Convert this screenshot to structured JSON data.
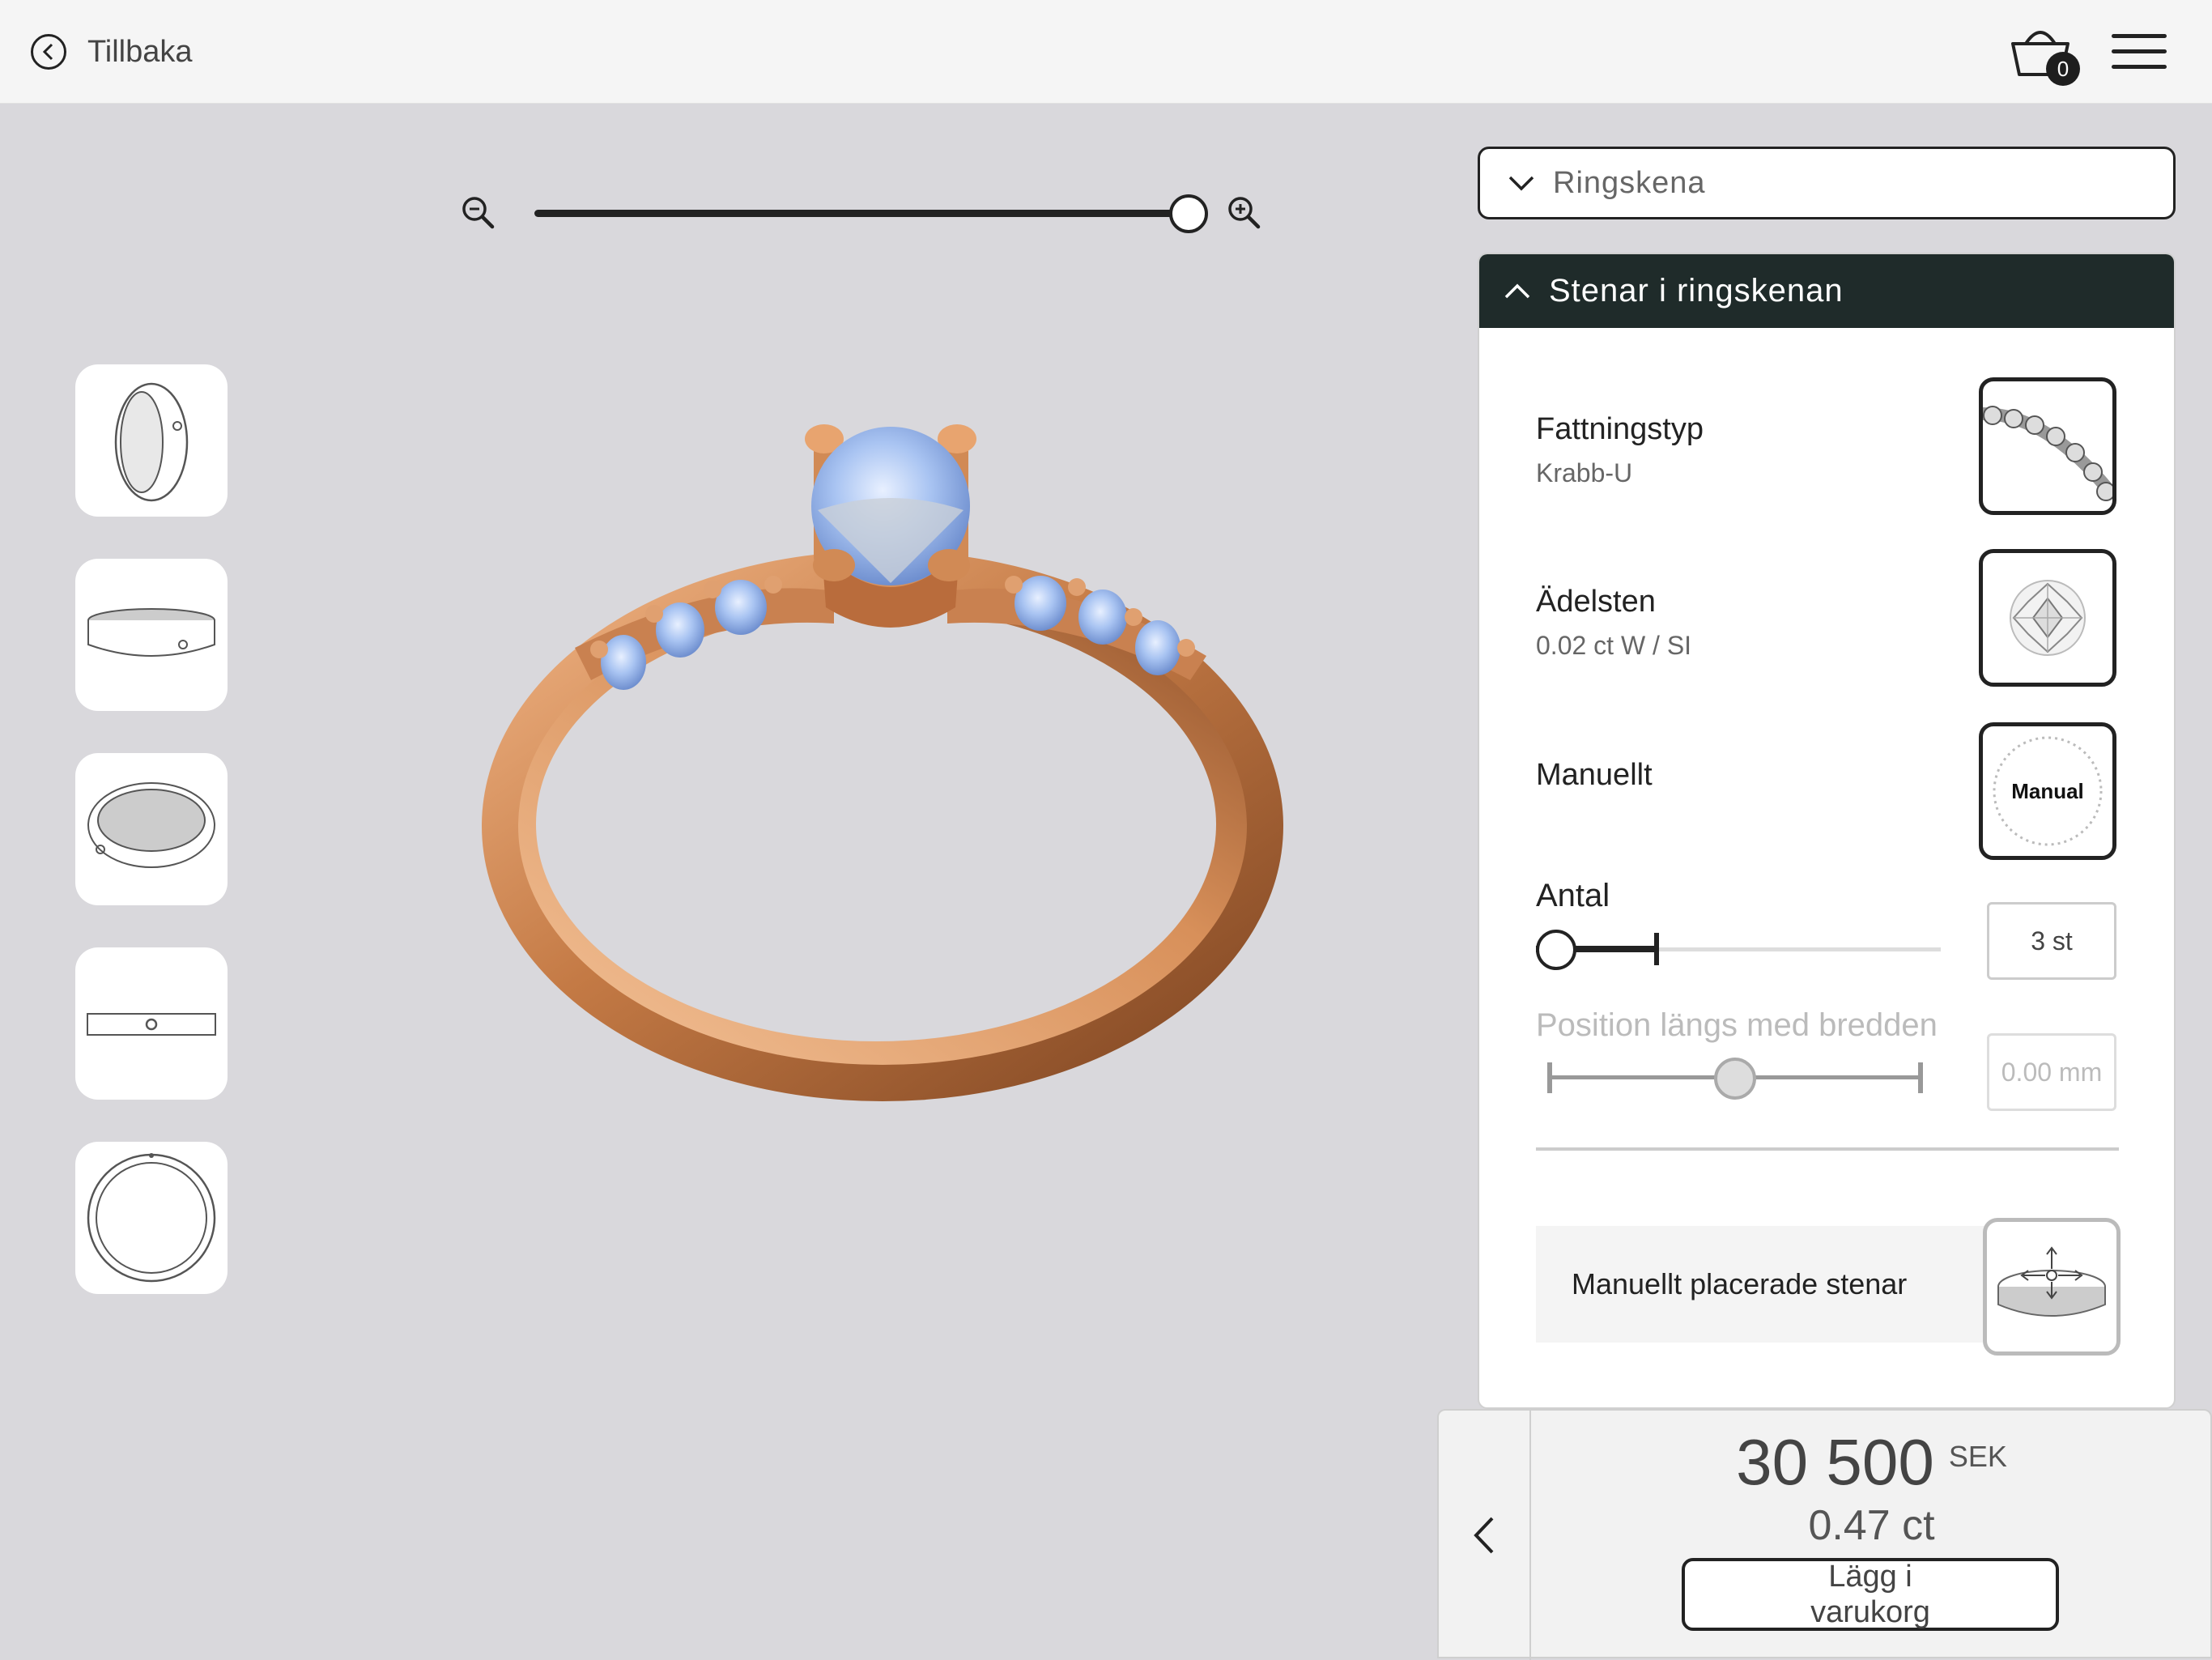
{
  "header": {
    "back_label": "Tillbaka",
    "cart_count": "0"
  },
  "zoom": {
    "level": 1.0
  },
  "thumbnails": [
    "perspective-view",
    "side-view",
    "top-angle-view",
    "front-view",
    "top-view"
  ],
  "panel": {
    "dropdown_label": "Ringskena",
    "section_title": "Stenar i ringskenan",
    "setting_type": {
      "title": "Fattningstyp",
      "value": "Krabb-U"
    },
    "gemstone": {
      "title": "Ädelsten",
      "value": "0.02 ct  W / SI"
    },
    "manual": {
      "title": "Manuellt",
      "badge": "Manual"
    },
    "count": {
      "label": "Antal",
      "value": "3 st",
      "slider_fraction": 0.0
    },
    "position": {
      "label": "Position längs med bredden",
      "value": "0.00 mm",
      "slider_fraction": 0.5
    },
    "manual_button_label": "Manuellt placerade stenar"
  },
  "footer": {
    "price": "30 500",
    "currency": "SEK",
    "carat": "0.47 ct",
    "add_to_cart": "Lägg i varukorg"
  },
  "colors": {
    "accent_dark": "#1f2b2a",
    "ring_gold": "#c47a45",
    "background": "#d9d8dc"
  }
}
